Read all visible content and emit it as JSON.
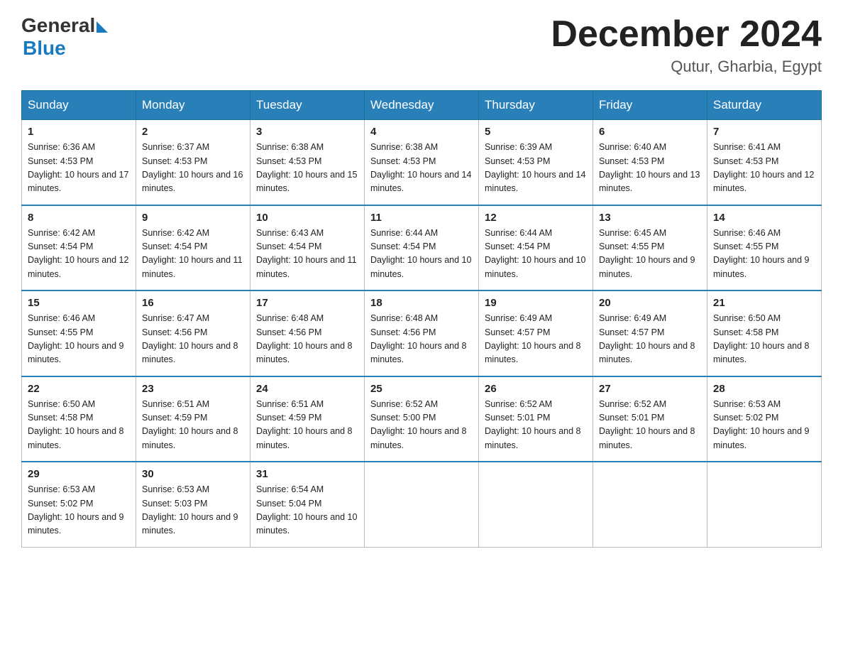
{
  "header": {
    "logo_general": "General",
    "logo_blue": "Blue",
    "month_title": "December 2024",
    "location": "Qutur, Gharbia, Egypt"
  },
  "weekdays": [
    "Sunday",
    "Monday",
    "Tuesday",
    "Wednesday",
    "Thursday",
    "Friday",
    "Saturday"
  ],
  "weeks": [
    [
      {
        "day": "1",
        "sunrise": "6:36 AM",
        "sunset": "4:53 PM",
        "daylight": "10 hours and 17 minutes."
      },
      {
        "day": "2",
        "sunrise": "6:37 AM",
        "sunset": "4:53 PM",
        "daylight": "10 hours and 16 minutes."
      },
      {
        "day": "3",
        "sunrise": "6:38 AM",
        "sunset": "4:53 PM",
        "daylight": "10 hours and 15 minutes."
      },
      {
        "day": "4",
        "sunrise": "6:38 AM",
        "sunset": "4:53 PM",
        "daylight": "10 hours and 14 minutes."
      },
      {
        "day": "5",
        "sunrise": "6:39 AM",
        "sunset": "4:53 PM",
        "daylight": "10 hours and 14 minutes."
      },
      {
        "day": "6",
        "sunrise": "6:40 AM",
        "sunset": "4:53 PM",
        "daylight": "10 hours and 13 minutes."
      },
      {
        "day": "7",
        "sunrise": "6:41 AM",
        "sunset": "4:53 PM",
        "daylight": "10 hours and 12 minutes."
      }
    ],
    [
      {
        "day": "8",
        "sunrise": "6:42 AM",
        "sunset": "4:54 PM",
        "daylight": "10 hours and 12 minutes."
      },
      {
        "day": "9",
        "sunrise": "6:42 AM",
        "sunset": "4:54 PM",
        "daylight": "10 hours and 11 minutes."
      },
      {
        "day": "10",
        "sunrise": "6:43 AM",
        "sunset": "4:54 PM",
        "daylight": "10 hours and 11 minutes."
      },
      {
        "day": "11",
        "sunrise": "6:44 AM",
        "sunset": "4:54 PM",
        "daylight": "10 hours and 10 minutes."
      },
      {
        "day": "12",
        "sunrise": "6:44 AM",
        "sunset": "4:54 PM",
        "daylight": "10 hours and 10 minutes."
      },
      {
        "day": "13",
        "sunrise": "6:45 AM",
        "sunset": "4:55 PM",
        "daylight": "10 hours and 9 minutes."
      },
      {
        "day": "14",
        "sunrise": "6:46 AM",
        "sunset": "4:55 PM",
        "daylight": "10 hours and 9 minutes."
      }
    ],
    [
      {
        "day": "15",
        "sunrise": "6:46 AM",
        "sunset": "4:55 PM",
        "daylight": "10 hours and 9 minutes."
      },
      {
        "day": "16",
        "sunrise": "6:47 AM",
        "sunset": "4:56 PM",
        "daylight": "10 hours and 8 minutes."
      },
      {
        "day": "17",
        "sunrise": "6:48 AM",
        "sunset": "4:56 PM",
        "daylight": "10 hours and 8 minutes."
      },
      {
        "day": "18",
        "sunrise": "6:48 AM",
        "sunset": "4:56 PM",
        "daylight": "10 hours and 8 minutes."
      },
      {
        "day": "19",
        "sunrise": "6:49 AM",
        "sunset": "4:57 PM",
        "daylight": "10 hours and 8 minutes."
      },
      {
        "day": "20",
        "sunrise": "6:49 AM",
        "sunset": "4:57 PM",
        "daylight": "10 hours and 8 minutes."
      },
      {
        "day": "21",
        "sunrise": "6:50 AM",
        "sunset": "4:58 PM",
        "daylight": "10 hours and 8 minutes."
      }
    ],
    [
      {
        "day": "22",
        "sunrise": "6:50 AM",
        "sunset": "4:58 PM",
        "daylight": "10 hours and 8 minutes."
      },
      {
        "day": "23",
        "sunrise": "6:51 AM",
        "sunset": "4:59 PM",
        "daylight": "10 hours and 8 minutes."
      },
      {
        "day": "24",
        "sunrise": "6:51 AM",
        "sunset": "4:59 PM",
        "daylight": "10 hours and 8 minutes."
      },
      {
        "day": "25",
        "sunrise": "6:52 AM",
        "sunset": "5:00 PM",
        "daylight": "10 hours and 8 minutes."
      },
      {
        "day": "26",
        "sunrise": "6:52 AM",
        "sunset": "5:01 PM",
        "daylight": "10 hours and 8 minutes."
      },
      {
        "day": "27",
        "sunrise": "6:52 AM",
        "sunset": "5:01 PM",
        "daylight": "10 hours and 8 minutes."
      },
      {
        "day": "28",
        "sunrise": "6:53 AM",
        "sunset": "5:02 PM",
        "daylight": "10 hours and 9 minutes."
      }
    ],
    [
      {
        "day": "29",
        "sunrise": "6:53 AM",
        "sunset": "5:02 PM",
        "daylight": "10 hours and 9 minutes."
      },
      {
        "day": "30",
        "sunrise": "6:53 AM",
        "sunset": "5:03 PM",
        "daylight": "10 hours and 9 minutes."
      },
      {
        "day": "31",
        "sunrise": "6:54 AM",
        "sunset": "5:04 PM",
        "daylight": "10 hours and 10 minutes."
      },
      null,
      null,
      null,
      null
    ]
  ]
}
